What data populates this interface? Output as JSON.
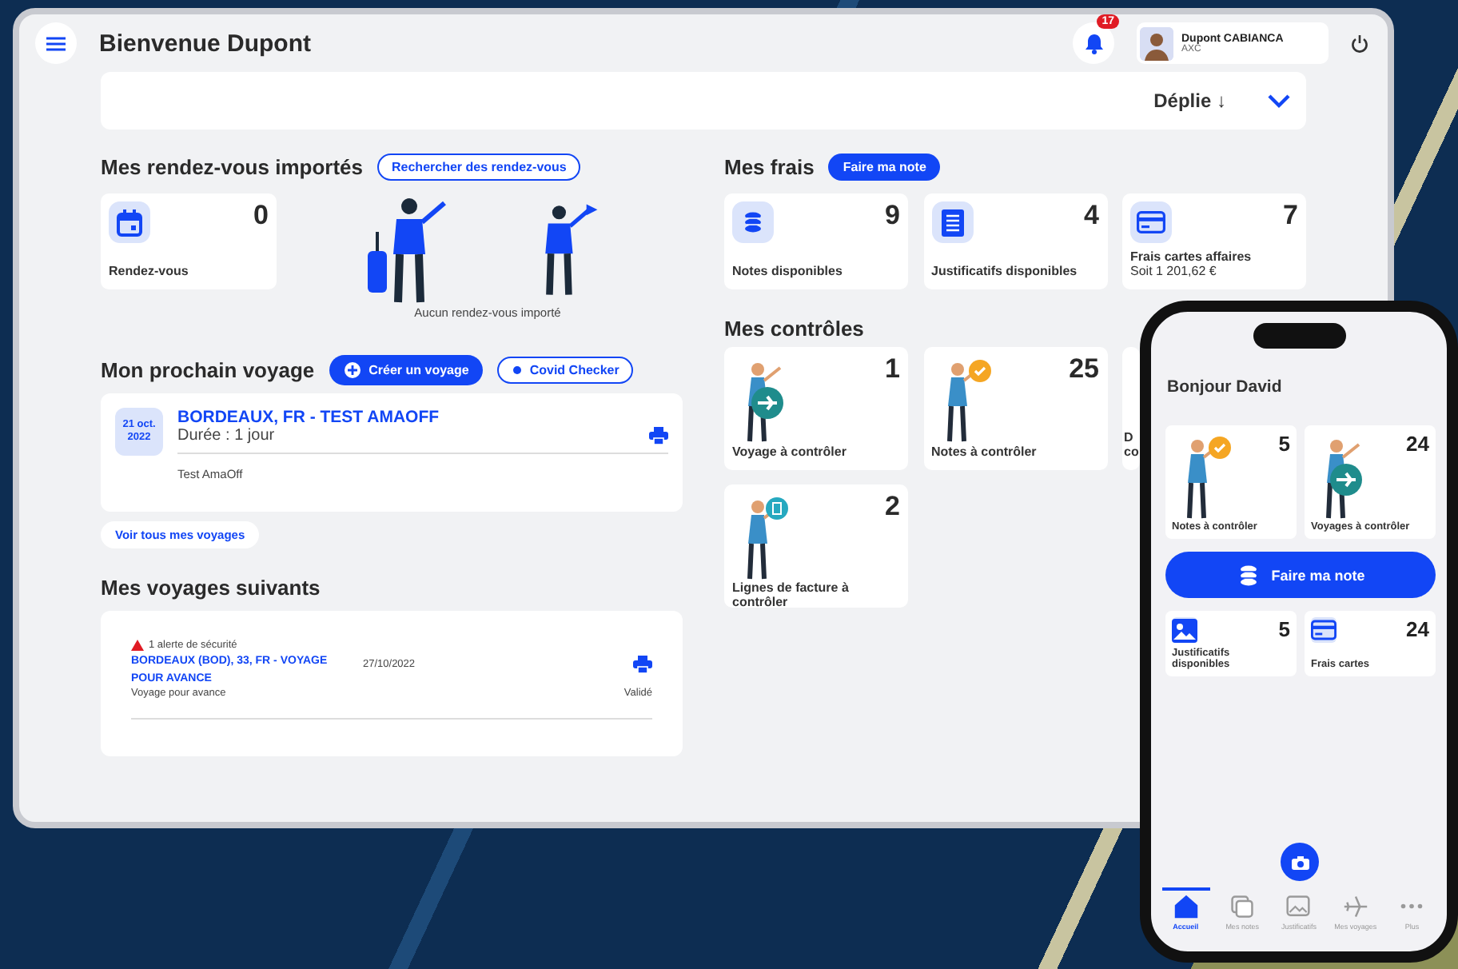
{
  "header": {
    "title": "Bienvenue Dupont",
    "notifications": "17",
    "user": {
      "name": "Dupont CABIANCA",
      "company": "AXC"
    }
  },
  "expand_bar": {
    "label": "Déplie ↓"
  },
  "appointments": {
    "title": "Mes rendez-vous importés",
    "button": "Rechercher des rendez-vous",
    "card": {
      "count": "0",
      "label": "Rendez-vous"
    },
    "empty_text": "Aucun rendez-vous importé"
  },
  "next_trip": {
    "title": "Mon prochain voyage",
    "buttons": [
      {
        "label": "Créer un voyage",
        "kind": "primary"
      },
      {
        "label": "Covid Checker",
        "kind": "outline"
      }
    ],
    "trip": {
      "date": "21 oct. 2022",
      "destination": "BORDEAUX, FR - TEST AMAOFF",
      "duration": "Durée : 1 jour",
      "note": "Test AmaOff"
    },
    "link": "Voir tous mes voyages"
  },
  "upcoming": {
    "title": "Mes voyages suivants",
    "trips": [
      {
        "alert": "1 alerte de sécurité",
        "destination": "BORDEAUX (BOD), 33, FR - VOYAGE POUR AVANCE",
        "date": "27/10/2022",
        "description": "Voyage pour avance",
        "status": "Validé"
      }
    ]
  },
  "expenses": {
    "title": "Mes frais",
    "button": "Faire ma note",
    "cards": [
      {
        "count": "9",
        "label": "Notes disponibles"
      },
      {
        "count": "4",
        "label": "Justificatifs disponibles"
      },
      {
        "count": "7",
        "label": "Frais cartes affaires",
        "sublabel": "Soit 1 201,62 €"
      }
    ]
  },
  "controls": {
    "title": "Mes contrôles",
    "cards": [
      {
        "count": "1",
        "label": "Voyage à contrôler"
      },
      {
        "count": "25",
        "label": "Notes à contrôler"
      },
      {
        "label": "D co"
      },
      {
        "count": "2",
        "label": "Lignes de facture à contrôler"
      }
    ]
  },
  "phone": {
    "greeting": "Bonjour David",
    "cards": [
      {
        "count": "5",
        "label": "Notes à contrôler"
      },
      {
        "count": "24",
        "label": "Voyages à contrôler"
      }
    ],
    "button": "Faire ma note",
    "small_cards": [
      {
        "count": "5",
        "label": "Justificatifs disponibles"
      },
      {
        "count": "24",
        "label": "Frais cartes"
      }
    ],
    "tabs": [
      {
        "label": "Accueil",
        "selected": true
      },
      {
        "label": "Mes notes",
        "selected": false
      },
      {
        "label": "Justificatifs",
        "selected": false
      },
      {
        "label": "Mes voyages",
        "selected": false
      },
      {
        "label": "Plus",
        "selected": false
      }
    ]
  }
}
